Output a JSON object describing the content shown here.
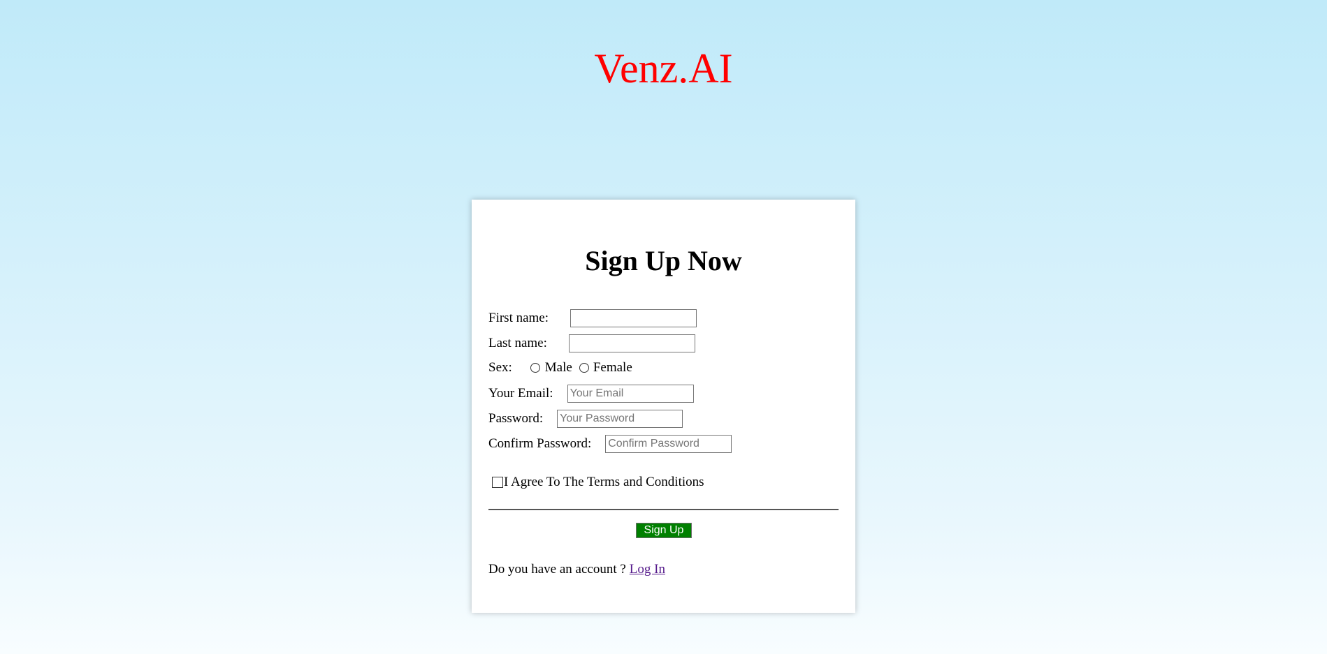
{
  "brand": {
    "name": "Venz.AI",
    "color": "#ff0000"
  },
  "form": {
    "title": "Sign Up Now",
    "first_name_label": "First name:",
    "last_name_label": "Last name:",
    "sex_label": "Sex:",
    "sex_options": [
      "Male",
      "Female"
    ],
    "email_label": "Your Email:",
    "email_placeholder": "Your Email",
    "password_label": "Password:",
    "password_placeholder": "Your Password",
    "confirm_password_label": "Confirm Password:",
    "confirm_password_placeholder": "Confirm Password",
    "terms_label": "I Agree To The Terms and Conditions",
    "submit_label": "Sign Up",
    "submit_color": "#008000",
    "account_prompt": "Do you have an account ?",
    "login_link": "Log In"
  }
}
